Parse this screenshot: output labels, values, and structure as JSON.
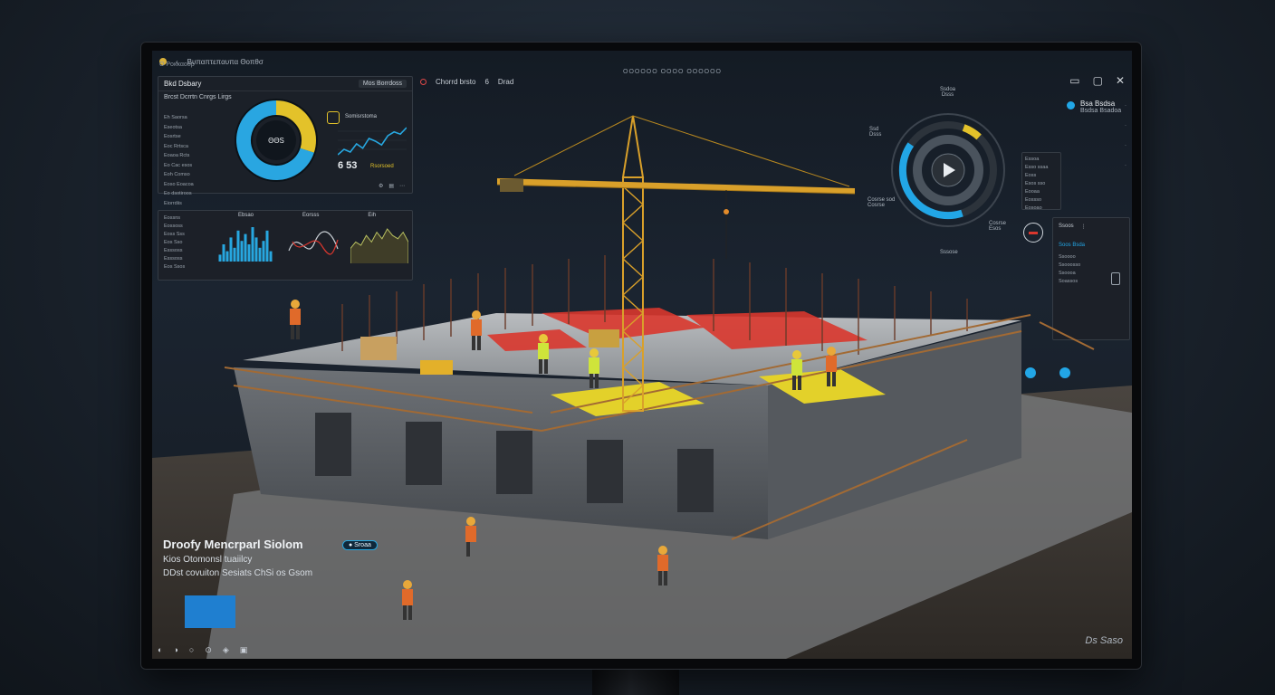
{
  "window": {
    "title": "Βυπαπτεπαυπα Θοπθσ",
    "subtitle": "Ο Ροκκαοδρ",
    "center_label": "ΟΟΟΟΟΟ ΟΟΟΟ ΟΟΟΟΟΟ",
    "controls": [
      "▭",
      "▢",
      "✕"
    ]
  },
  "view_toolbar": {
    "label": "Chorrd brsto",
    "value": "6",
    "mode": "Drad"
  },
  "dashboard_panel": {
    "title": "Bkd Dsbary",
    "button": "Mos Borrdoss",
    "subtitle": "Brcst Dcrrtn Cnrgs Lirgs",
    "list": [
      "Eh Saorsa",
      "Eseotsa",
      "Eosrtse",
      "Eoc Rrtsca",
      "Eoaoa Rcts",
      "Eo Cac esos",
      "Eoh Comso",
      "Eoso Eoacoa",
      "Eo dsotiroos",
      "Eiorrdiis"
    ],
    "donut_label": "ΘΘS",
    "donut": {
      "done": 0.3,
      "remaining": 0.7,
      "done_color": "#e3c22a",
      "rest_color": "#29a6e1"
    },
    "trend_label": "Somisrstoma",
    "trend_values": [
      3,
      4,
      3.5,
      5,
      4.2,
      6,
      5.5,
      4.8,
      6.5,
      7.2,
      6.8,
      8
    ],
    "stat_value": "6 53",
    "stat_note": "Rsorsoed"
  },
  "charts_panel": {
    "tabs": [
      "Ebsao",
      "Eorsss",
      "Eih"
    ],
    "list": [
      "Eossns",
      "Eossoss",
      "Eoss Sss",
      "Eos Sso",
      "Esssoss",
      "Esssoss",
      "Eos Ssos"
    ],
    "bars": [
      2,
      5,
      3,
      7,
      4,
      9,
      6,
      8,
      5,
      10,
      7,
      4,
      6,
      9,
      3
    ],
    "area_values": [
      4,
      6,
      5,
      8,
      6,
      9,
      7,
      10,
      8,
      7,
      9,
      6
    ]
  },
  "ring_gauge": {
    "top_label": "Ssdoa\nDsss",
    "left_label": "Ssd\nDsss",
    "bottom_left_label": "Cosrse sod\nCosrse",
    "bottom_right_label": "Cosrse\nEsos",
    "bottom_label": "Sssose",
    "progress": 0.72,
    "accent": "#22a6e6",
    "secondary": "#e3c22a"
  },
  "right_side": {
    "card_title": "Bsa Bsdsa",
    "card_sub": "Bsdsa Bsadoa",
    "table_rows": [
      "Essoa",
      "Esso ssaa",
      "Eoss",
      "Esos sso",
      "Eooaa",
      "Eossso",
      "Eosoao"
    ],
    "info_lines": [
      "Ssoos",
      "Ssoooo",
      "Ssooosso",
      "Ssoooa",
      "Soassos"
    ],
    "status_label": "Soos Bsda"
  },
  "caption": {
    "title": "Droofy Mencrparl Siolom",
    "badge": "● Sroaa",
    "line1": "Kios Otomonsl tuaiilcy",
    "line2": "DDst covuiton Sesiats ChSi os Gsom"
  },
  "bottom_bar": [
    "◐",
    "◑",
    "○",
    "⊙",
    "◈",
    "▣"
  ],
  "signature": "Ds Saso",
  "colors": {
    "accent_blue": "#22a6e6",
    "accent_yellow": "#e3c22a",
    "danger_red": "#d9372e",
    "crane_yellow": "#d9a02a"
  }
}
